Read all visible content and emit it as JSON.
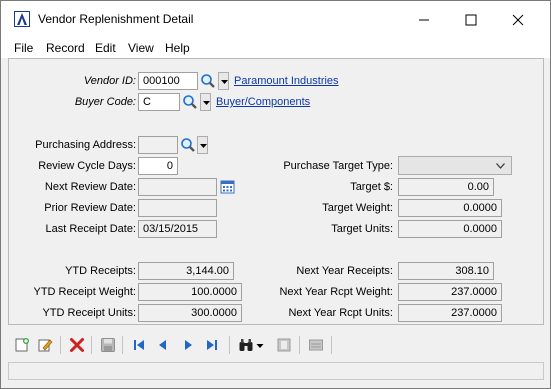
{
  "window": {
    "title": "Vendor Replenishment Detail",
    "accent": "#1b3a8c",
    "link_color": "#0b37a8"
  },
  "menu": [
    "File",
    "Record",
    "Edit",
    "View",
    "Help"
  ],
  "form": {
    "vendor_id": {
      "label": "Vendor ID:",
      "value": "000100",
      "link": "Paramount Industries"
    },
    "buyer_code": {
      "label": "Buyer Code:",
      "value": "C",
      "link": "Buyer/Components"
    },
    "purchasing_address": {
      "label": "Purchasing Address:",
      "value": ""
    },
    "review_cycle_days": {
      "label": "Review Cycle Days:",
      "value": "0"
    },
    "next_review_date": {
      "label": "Next Review Date:",
      "value": ""
    },
    "prior_review_date": {
      "label": "Prior Review Date:",
      "value": ""
    },
    "last_receipt_date": {
      "label": "Last Receipt Date:",
      "value": "03/15/2015"
    },
    "purchase_target_type": {
      "label": "Purchase Target Type:",
      "value": ""
    },
    "target_amount": {
      "label": "Target $:",
      "value": "0.00"
    },
    "target_weight": {
      "label": "Target Weight:",
      "value": "0.0000"
    },
    "target_units": {
      "label": "Target Units:",
      "value": "0.0000"
    },
    "ytd_receipts": {
      "label": "YTD Receipts:",
      "value": "3,144.00"
    },
    "ytd_receipt_weight": {
      "label": "YTD Receipt Weight:",
      "value": "100.0000"
    },
    "ytd_receipt_units": {
      "label": "YTD Receipt Units:",
      "value": "300.0000"
    },
    "next_year_receipts": {
      "label": "Next Year Receipts:",
      "value": "308.10"
    },
    "next_year_rcpt_weight": {
      "label": "Next Year Rcpt Weight:",
      "value": "237.0000"
    },
    "next_year_rcpt_units": {
      "label": "Next Year Rcpt Units:",
      "value": "237.0000"
    }
  },
  "toolbar_icons": [
    "new-record-icon",
    "edit-record-icon",
    "delete-icon",
    "save-icon",
    "first-record-icon",
    "previous-record-icon",
    "next-record-icon",
    "last-record-icon",
    "find-binoculars-icon",
    "find-dropdown-icon",
    "notes-icon",
    "list-icon"
  ]
}
